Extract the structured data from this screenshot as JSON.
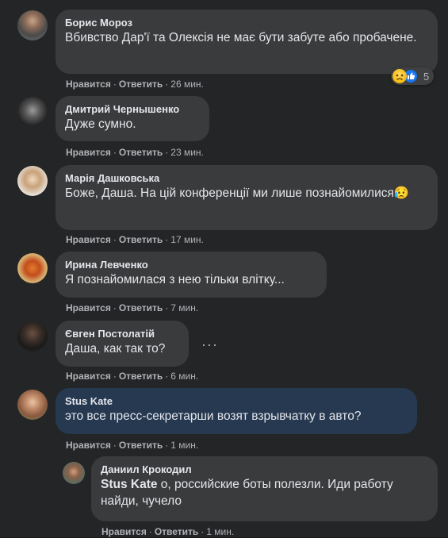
{
  "actions": {
    "like": "Нравится",
    "reply": "Ответить",
    "sep": "·"
  },
  "comments": [
    {
      "author": "Борис Мороз",
      "text": "Вбивство Дар'ї та Олексія не має бути забуте або пробачене.",
      "time": "26 мин.",
      "reactions": {
        "count": "5",
        "icons": [
          "sad-icon",
          "like-icon"
        ]
      }
    },
    {
      "author": "Дмитрий Чернышенко",
      "text": "Дуже сумно.",
      "time": "23 мин."
    },
    {
      "author": "Марія Дашковська",
      "text": "Боже, Даша. На цій конференції ми лише познайомилися😥",
      "time": "17 мин."
    },
    {
      "author": "Ирина Левченко",
      "text": "Я познайомилася з нею тільки влітку...",
      "time": "7 мин."
    },
    {
      "author": "Євген Постолатій",
      "text": "Даша, как так то?",
      "time": "6 мин.",
      "more": "···"
    },
    {
      "author": "Stus Kate",
      "text": "это все пресс-секретарши возят взрывчатку в авто?",
      "time": "1 мин."
    }
  ],
  "reply": {
    "author": "Даниил Крокодил",
    "mention": "Stus Kate",
    "text": " о, российские боты полезли. Иди работу найди, чучело",
    "time": "1 мин."
  },
  "colors": {
    "background": "#242526",
    "bubble": "#3a3b3c",
    "highlight_bubble": "#263951",
    "meta_text": "#b0b3b8"
  }
}
